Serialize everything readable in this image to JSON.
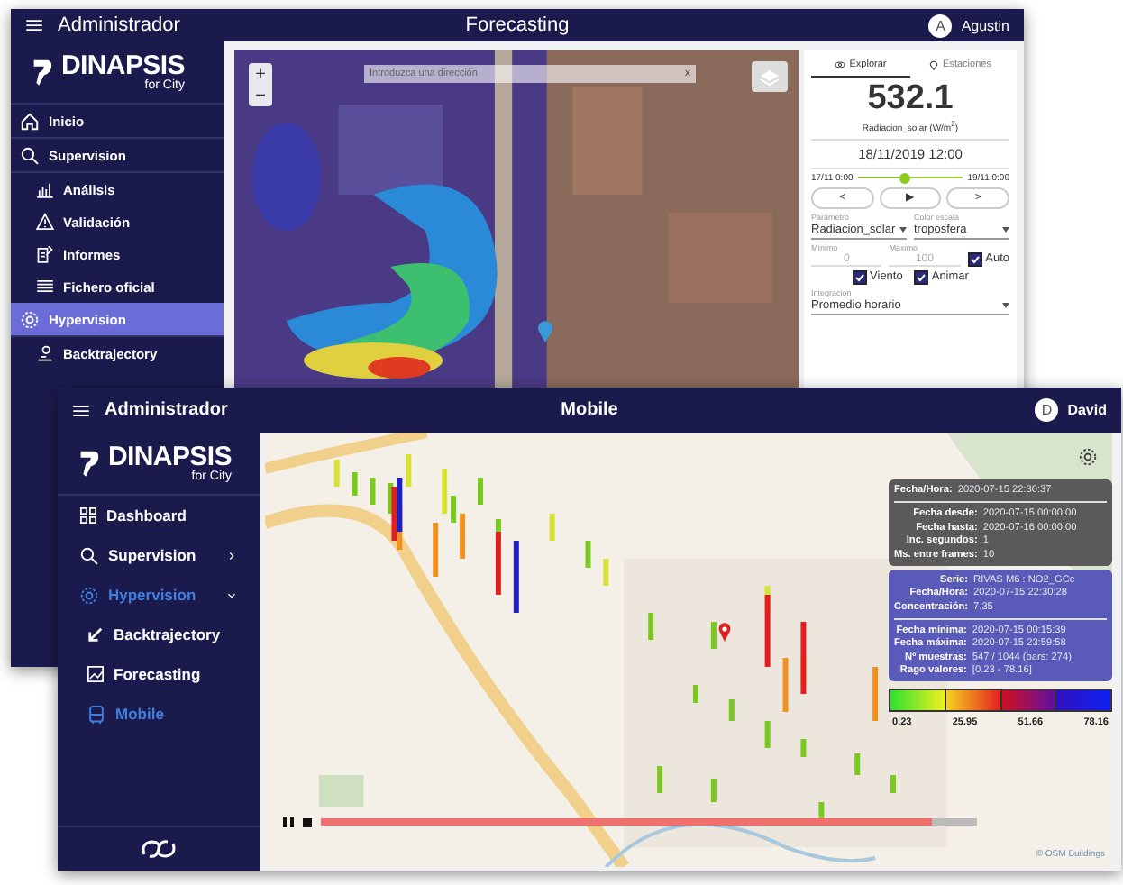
{
  "back_window": {
    "menu_title": "Administrador",
    "title": "Forecasting",
    "user": {
      "initial": "A",
      "name": "Agustin"
    },
    "brand": {
      "name": "DINAPSIS",
      "tagline": "for City"
    },
    "sidebar": {
      "items": [
        {
          "label": "Inicio",
          "selected": false
        },
        {
          "label": "Supervision",
          "selected": false,
          "children": [
            {
              "label": "Análisis"
            },
            {
              "label": "Validación"
            },
            {
              "label": "Informes"
            },
            {
              "label": "Fichero oficial"
            }
          ]
        },
        {
          "label": "Hypervision",
          "selected": true,
          "children": [
            {
              "label": "Backtrajectory"
            }
          ]
        }
      ]
    },
    "map": {
      "zoom_in": "+",
      "zoom_out": "−",
      "search": {
        "placeholder": "Introduzca una dirección",
        "clear": "x"
      }
    },
    "panel": {
      "tabs": [
        {
          "label": "Explorar",
          "selected": true
        },
        {
          "label": "Estaciones",
          "selected": false
        }
      ],
      "value": "532.1",
      "unit": "Radiacion_solar (W/m$^{2}$)",
      "datetime": "18/11/2019 12:00",
      "time_slider": {
        "start": "17/11 0:00",
        "end": "19/11 0:00",
        "level": 0.45
      },
      "nav_buttons": [
        "<",
        "▶",
        ">"
      ],
      "parameter": {
        "label": "Parámetro",
        "value": "Radiacion_solar"
      },
      "color_scale": {
        "label": "Color escala",
        "value": "troposfera"
      },
      "minimum": {
        "label": "Mínimo",
        "placeholder": "0"
      },
      "maximum": {
        "label": "Máximo",
        "placeholder": "100"
      },
      "checks": [
        {
          "label": "Auto",
          "checked": true
        },
        {
          "label": "Viento",
          "checked": true
        },
        {
          "label": "Animar",
          "checked": true
        }
      ],
      "integration": {
        "label": "Integración",
        "value": "Promedio horario"
      }
    }
  },
  "front_window": {
    "menu_title": "Administrador",
    "title": "Mobile",
    "user": {
      "initial": "D",
      "name": "David"
    },
    "brand": {
      "name": "DINAPSIS",
      "tagline": "for City"
    },
    "sidebar": {
      "items": [
        {
          "label": "Dashboard",
          "selected": false
        },
        {
          "label": "Supervision",
          "selected": false,
          "expanded": false
        },
        {
          "label": "Hypervision",
          "selected": true,
          "expanded": true,
          "children": [
            {
              "label": "Backtrajectory",
              "selected": false
            },
            {
              "label": "Forecasting",
              "selected": false
            },
            {
              "label": "Mobile",
              "selected": true
            }
          ]
        }
      ]
    },
    "info": {
      "playback": [
        {
          "label": "Fecha/Hora:",
          "value": "2020-07-15 22:30:37"
        }
      ],
      "range": [
        {
          "label": "Fecha desde:",
          "value": "2020-07-15 00:00:00"
        },
        {
          "label": "Fecha hasta:",
          "value": "2020-07-16 00:00:00"
        },
        {
          "label": "Inc. segundos:",
          "value": "1"
        },
        {
          "label": "Ms. entre frames:",
          "value": "10"
        }
      ],
      "series": [
        {
          "label": "Serie:",
          "value": "RIVAS M6 : NO2_GCc"
        },
        {
          "label": "Fecha/Hora:",
          "value": "2020-07-15 22:30:28"
        },
        {
          "label": "Concentración:",
          "value": "7.35"
        }
      ],
      "stats": [
        {
          "label": "Fecha mínima:",
          "value": "2020-07-15 00:15:39"
        },
        {
          "label": "Fecha máxima:",
          "value": "2020-07-15 23:59:58"
        },
        {
          "label": "Nº muestras:",
          "value": "547 / 1044 (bars: 274)"
        },
        {
          "label": "Rago valores:",
          "value": "[0.23 - 78.16]"
        }
      ]
    },
    "legend": [
      "0.23",
      "25.95",
      "51.66",
      "78.16"
    ],
    "progress": {
      "level": 0.93
    },
    "attribution": "© OSM Buildings"
  }
}
